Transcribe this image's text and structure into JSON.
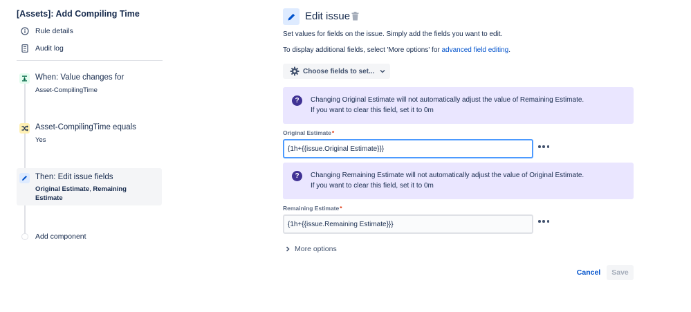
{
  "rule": {
    "title": "[Assets]: Add Compiling Time",
    "links": [
      {
        "label": "Rule details",
        "icon": "info-icon"
      },
      {
        "label": "Audit log",
        "icon": "document-icon"
      }
    ]
  },
  "steps": {
    "trigger": {
      "title": "When: Value changes for",
      "sub": "Asset-CompilingTime",
      "icon": "trigger-icon"
    },
    "condition": {
      "title": "Asset-CompilingTime equals",
      "sub": "Yes",
      "icon": "shuffle-icon"
    },
    "action": {
      "title": "Then: Edit issue fields",
      "field1": "Original Estimate",
      "sep": ",",
      "field2": "Remaining Estimate",
      "icon": "pencil-icon"
    },
    "add_label": "Add component"
  },
  "panel": {
    "title": "Edit issue",
    "desc1": "Set values for fields on the issue. Simply add the fields you want to edit.",
    "desc2_prefix": "To display additional fields, select 'More options' for ",
    "desc2_link": "advanced field editing",
    "desc2_suffix": ".",
    "choose_label": "Choose fields to set...",
    "info1": {
      "line1": "Changing Original Estimate will not automatically adjust the value of Remaining Estimate.",
      "line2": "If you want to clear this field, set it to 0m"
    },
    "field1": {
      "label": "Original Estimate",
      "required": "*",
      "value": "{1h+{{issue.Original Estimate}}}"
    },
    "info2": {
      "line1": "Changing Remaining Estimate will not automatically adjust the value of Original Estimate.",
      "line2": "If you want to clear this field, set it to 0m"
    },
    "field2": {
      "label": "Remaining Estimate",
      "required": "*",
      "value": "{1h+{{issue.Remaining Estimate}}}"
    },
    "more_options": "More options",
    "cancel": "Cancel",
    "save": "Save"
  },
  "colors": {
    "accent": "#0052cc",
    "info_bg": "#eae6ff",
    "info_icon": "#403294",
    "focus_border": "#4c9aff",
    "required": "#de350b"
  }
}
